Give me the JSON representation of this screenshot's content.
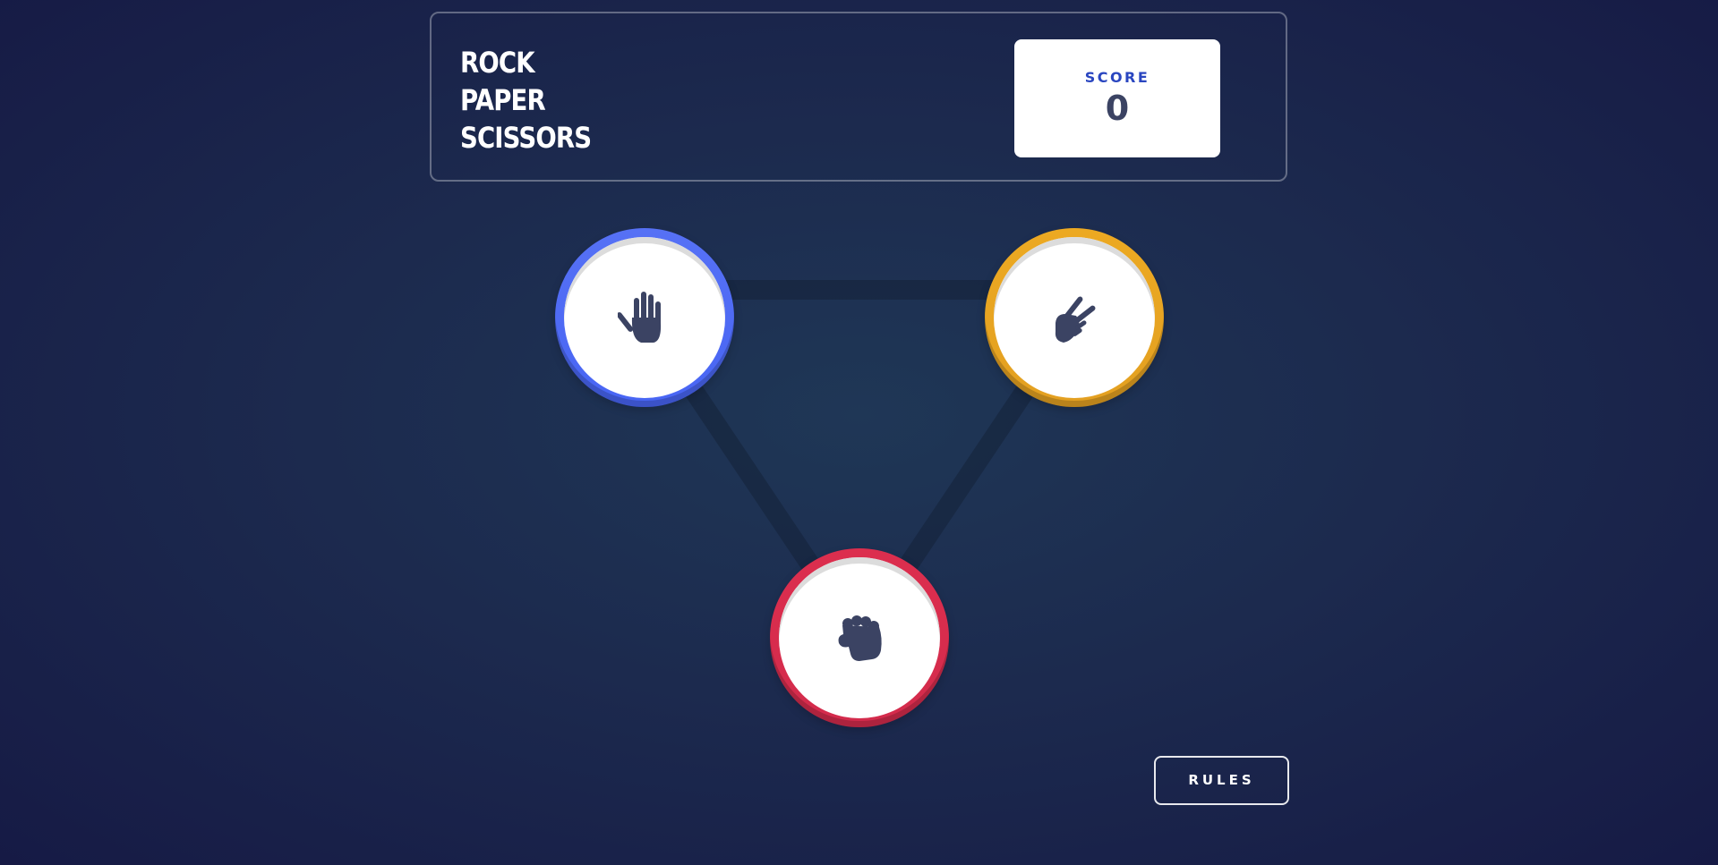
{
  "header": {
    "title_lines": [
      "ROCK",
      "PAPER",
      "SCISSORS"
    ],
    "score_label": "SCORE",
    "score_value": "0"
  },
  "choices": [
    {
      "name": "paper",
      "icon": "paper-hand-icon",
      "color": "#4865f4"
    },
    {
      "name": "scissors",
      "icon": "scissors-hand-icon",
      "color": "#eca922"
    },
    {
      "name": "rock",
      "icon": "rock-fist-icon",
      "color": "#dc2e4e"
    }
  ],
  "rules_label": "RULES",
  "colors": {
    "background": "#1f3756",
    "icon": "#3b4363",
    "score_label": "#2a46c0"
  }
}
